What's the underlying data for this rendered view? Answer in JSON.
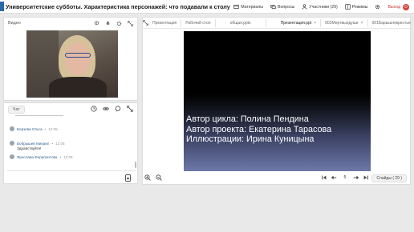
{
  "header": {
    "title": "Университетские субботы. Характеристика персонажей: что подавали к столу",
    "materials": "Материалы",
    "questions": "Вопросы",
    "participants": "Участники (29)",
    "modes": "Режимы",
    "exit": "Выход",
    "accent": "#d64541"
  },
  "video": {
    "label": "Видео"
  },
  "chat": {
    "tab": "Чат",
    "messages": [
      {
        "name": "Борзова Ольга",
        "time": "12:05",
        "text": ""
      },
      {
        "name": "Бобрышев Михаил",
        "time": "12:06",
        "text": "Здравствуйте!"
      },
      {
        "name": "Ярослава Ферапонтова",
        "time": "12:06",
        "text": ""
      }
    ]
  },
  "presentation": {
    "tabs": [
      {
        "label": "Презентация"
      },
      {
        "label": "Рабочий стол"
      },
      {
        "label": "общая.pptx"
      },
      {
        "label": "Презентация.ppt"
      },
      {
        "label": "002Мертвыедуши"
      },
      {
        "label": "001Барышнякрестья"
      }
    ],
    "slide_lines": [
      "Автор цикла: Полина Пендина",
      "Автор проекта: Екатерина Тарасова",
      "Иллюстрации: Ирина Куницына"
    ],
    "page": "5",
    "slides_count": "Слайды ( 29 )"
  }
}
